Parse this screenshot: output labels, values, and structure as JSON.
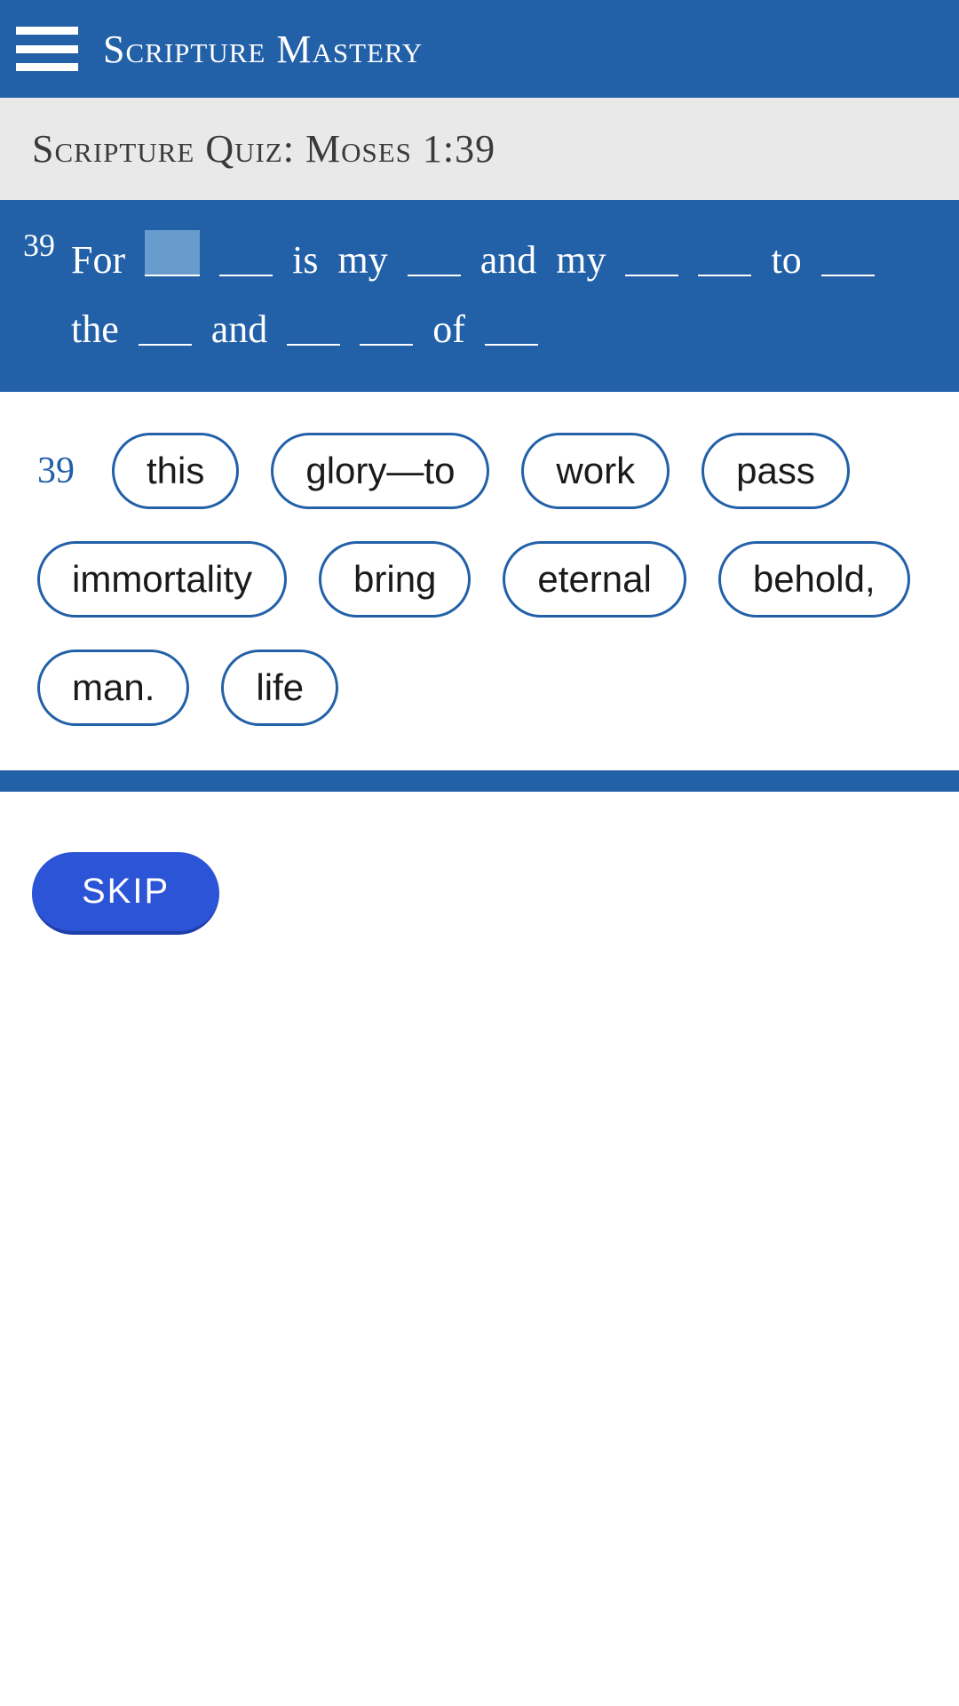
{
  "header": {
    "app_title": "Scripture Mastery"
  },
  "subheader": {
    "quiz_title": "Scripture Quiz: Moses 1:39"
  },
  "verse": {
    "number": "39",
    "tokens": [
      {
        "type": "word",
        "text": "For"
      },
      {
        "type": "blank",
        "active": true
      },
      {
        "type": "blank"
      },
      {
        "type": "word",
        "text": "is"
      },
      {
        "type": "word",
        "text": "my"
      },
      {
        "type": "blank"
      },
      {
        "type": "word",
        "text": "and"
      },
      {
        "type": "word",
        "text": "my"
      },
      {
        "type": "blank"
      },
      {
        "type": "blank"
      },
      {
        "type": "word",
        "text": "to"
      },
      {
        "type": "blank"
      },
      {
        "type": "word",
        "text": "the"
      },
      {
        "type": "blank"
      },
      {
        "type": "word",
        "text": "and"
      },
      {
        "type": "blank"
      },
      {
        "type": "blank"
      },
      {
        "type": "word",
        "text": "of"
      },
      {
        "type": "blank"
      }
    ]
  },
  "choices": {
    "number": "39",
    "items": [
      "this",
      "glory—to",
      "work",
      "pass",
      "immortality",
      "bring",
      "eternal",
      "behold,",
      "man.",
      "life"
    ]
  },
  "buttons": {
    "skip": "SKIP"
  }
}
